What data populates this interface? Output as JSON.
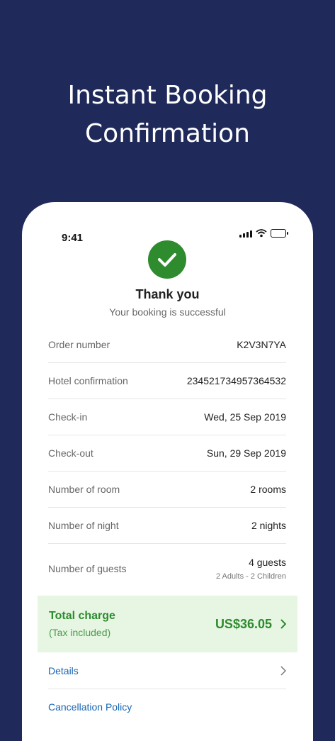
{
  "headline": {
    "line1": "Instant Booking",
    "line2": "Confirmation"
  },
  "status": {
    "time": "9:41"
  },
  "confirmation": {
    "title": "Thank you",
    "subtitle": "Your booking is successful"
  },
  "details": [
    {
      "label": "Order number",
      "value": "K2V3N7YA"
    },
    {
      "label": "Hotel confirmation",
      "value": "234521734957364532"
    },
    {
      "label": "Check-in",
      "value": "Wed, 25 Sep 2019"
    },
    {
      "label": "Check-out",
      "value": "Sun, 29 Sep 2019"
    },
    {
      "label": "Number of room",
      "value": "2 rooms"
    },
    {
      "label": "Number of night",
      "value": "2 nights"
    },
    {
      "label": "Number of guests",
      "value": "4 guests",
      "sub": "2 Adults - 2 Children"
    }
  ],
  "total": {
    "label": "Total charge",
    "note": "(Tax included)",
    "amount": "US$36.05"
  },
  "links": {
    "details": "Details",
    "cancellation": "Cancellation Policy"
  },
  "colors": {
    "background": "#1f2a5a",
    "accent_green": "#2e8b2e",
    "link_blue": "#1a66b3"
  }
}
